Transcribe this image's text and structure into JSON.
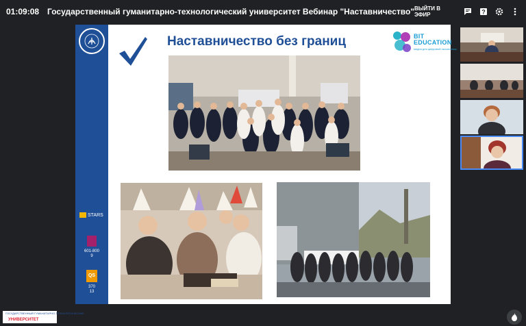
{
  "topbar": {
    "time": "01:09:08",
    "title": "Государственный гуманитарно-технологический университет  Вебинар \"Наставничество\"",
    "leave_label": "ВЫЙТИ В ЭФИР",
    "icons": [
      "chat-icon",
      "help-icon",
      "settings-icon",
      "more-icon"
    ]
  },
  "slide": {
    "title": "Наставничество  без границ",
    "bit_logo": {
      "name": "BIT EDUCATION",
      "subtitle": "медиа для цифровой экосистемы"
    },
    "rankings": {
      "stars": "STARS",
      "the_numbers": "601-800\n9",
      "qs_label": "QS",
      "qs_numbers": "370\n13"
    },
    "photos": [
      "group-photo",
      "workshop-photo",
      "outdoor-photo"
    ]
  },
  "participants": [
    "participant-tile-1",
    "participant-tile-2",
    "participant-tile-3",
    "participant-tile-4"
  ],
  "bottom_logo": {
    "top": "ГОСУДАРСТВЕННЫЙ ГУМАНИТАРНО-ТЕХНОЛОГИЧЕСКИЙ",
    "name": "УНИВЕРСИТЕТ"
  },
  "colors": {
    "background": "#202124",
    "slide_blue": "#1f4f96",
    "active_border": "#4a8cf7",
    "bit_blue": "#1a9cd6"
  }
}
